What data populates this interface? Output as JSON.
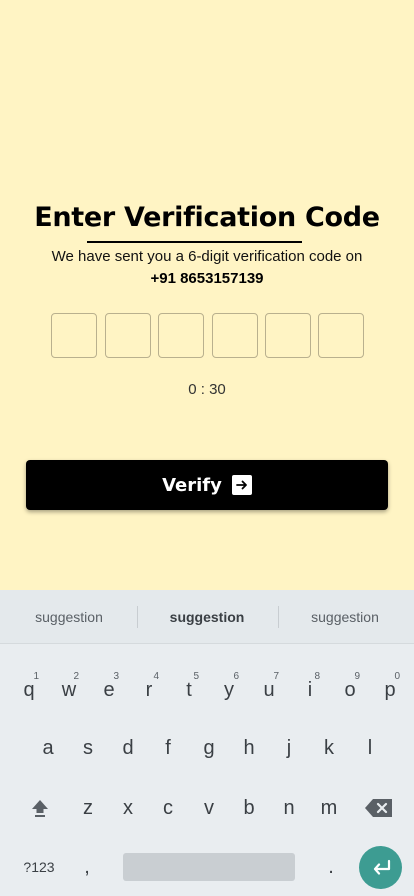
{
  "verification": {
    "title": "Enter Verification Code",
    "subtitle": "We have sent you a 6-digit verification code on",
    "phone": "+91 8653157139",
    "otp_digits": [
      "",
      "",
      "",
      "",
      "",
      ""
    ],
    "timer": "0 : 30",
    "verify_label": "Verify",
    "colors": {
      "background": "#FFF4C4",
      "button": "#000000",
      "box_border": "#B9B08E"
    }
  },
  "keyboard": {
    "suggestions": [
      "suggestion",
      "suggestion",
      "suggestion"
    ],
    "row1": [
      {
        "key": "q",
        "hint": "1"
      },
      {
        "key": "w",
        "hint": "2"
      },
      {
        "key": "e",
        "hint": "3"
      },
      {
        "key": "r",
        "hint": "4"
      },
      {
        "key": "t",
        "hint": "5"
      },
      {
        "key": "y",
        "hint": "6"
      },
      {
        "key": "u",
        "hint": "7"
      },
      {
        "key": "i",
        "hint": "8"
      },
      {
        "key": "o",
        "hint": "9"
      },
      {
        "key": "p",
        "hint": "0"
      }
    ],
    "row2": [
      "a",
      "s",
      "d",
      "f",
      "g",
      "h",
      "j",
      "k",
      "l"
    ],
    "row3": [
      "z",
      "x",
      "c",
      "v",
      "b",
      "n",
      "m"
    ],
    "symbols_label": "?123",
    "comma": ",",
    "period": ".",
    "icons": {
      "shift": "shift-icon",
      "backspace": "backspace-icon",
      "enter": "enter-icon"
    },
    "colors": {
      "enter": "#3D9C92"
    }
  }
}
